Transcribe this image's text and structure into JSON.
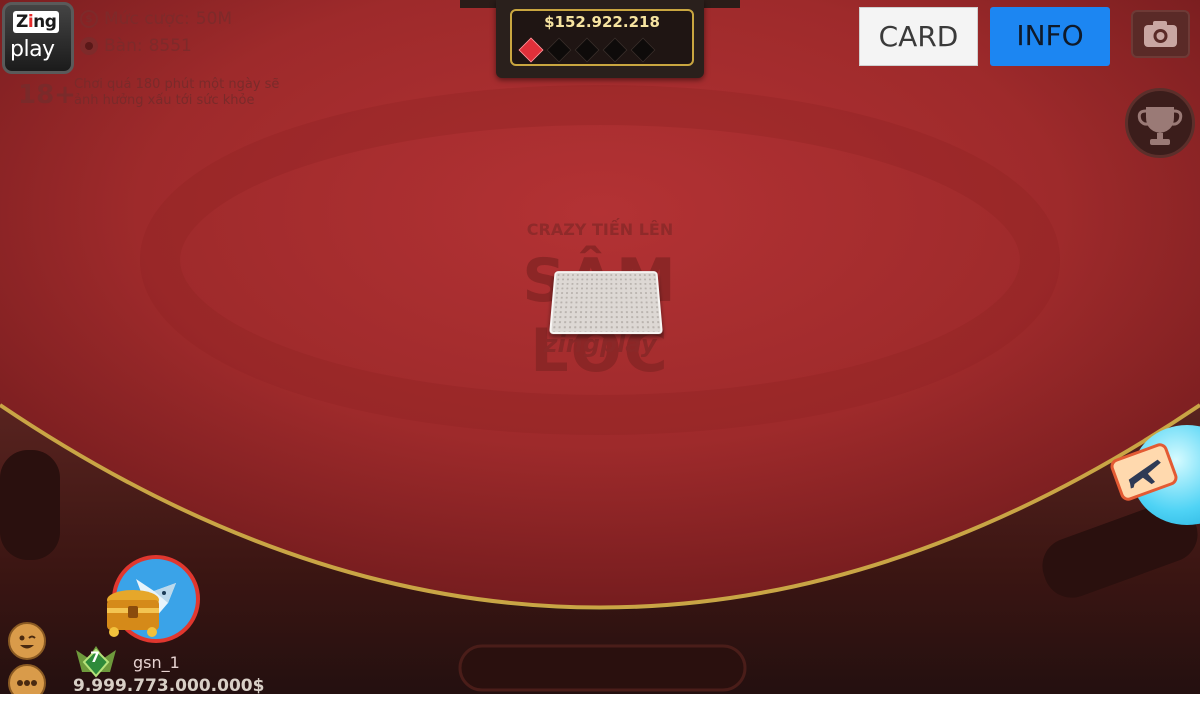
{
  "logo": {
    "line1_a": "Z",
    "line1_b": "i",
    "line1_c": "ng",
    "line2": "play"
  },
  "bet_label": "Mức cược:",
  "bet_value": "50M",
  "table_label": "Bàn:",
  "table_value": "8551",
  "age_rating": "18+",
  "health_warning": "Chơi quá 180 phút một ngày sẽ ảnh hưởng xấu tới sức khỏe",
  "jackpot": {
    "amount": "$152.922.218",
    "gems_active": 1,
    "gems_total": 5
  },
  "buttons": {
    "card": "CARD",
    "info": "INFO"
  },
  "table_logo": {
    "subtitle": "CRAZY TIẾN LÊN",
    "title": "SÂM LỐC",
    "brand": "zingplay"
  },
  "player": {
    "name": "gsn_1",
    "money": "9.999.773.000.000$",
    "level": "7"
  },
  "icons": {
    "camera": "camera-icon",
    "trophy": "trophy-icon",
    "plane": "airplane-ticket-icon",
    "emoji": "emoji-icon",
    "chat": "chat-icon"
  },
  "colors": {
    "felt": "#9e2a2b",
    "info_button": "#1c86f2",
    "jackpot_gold": "#c9a640"
  }
}
